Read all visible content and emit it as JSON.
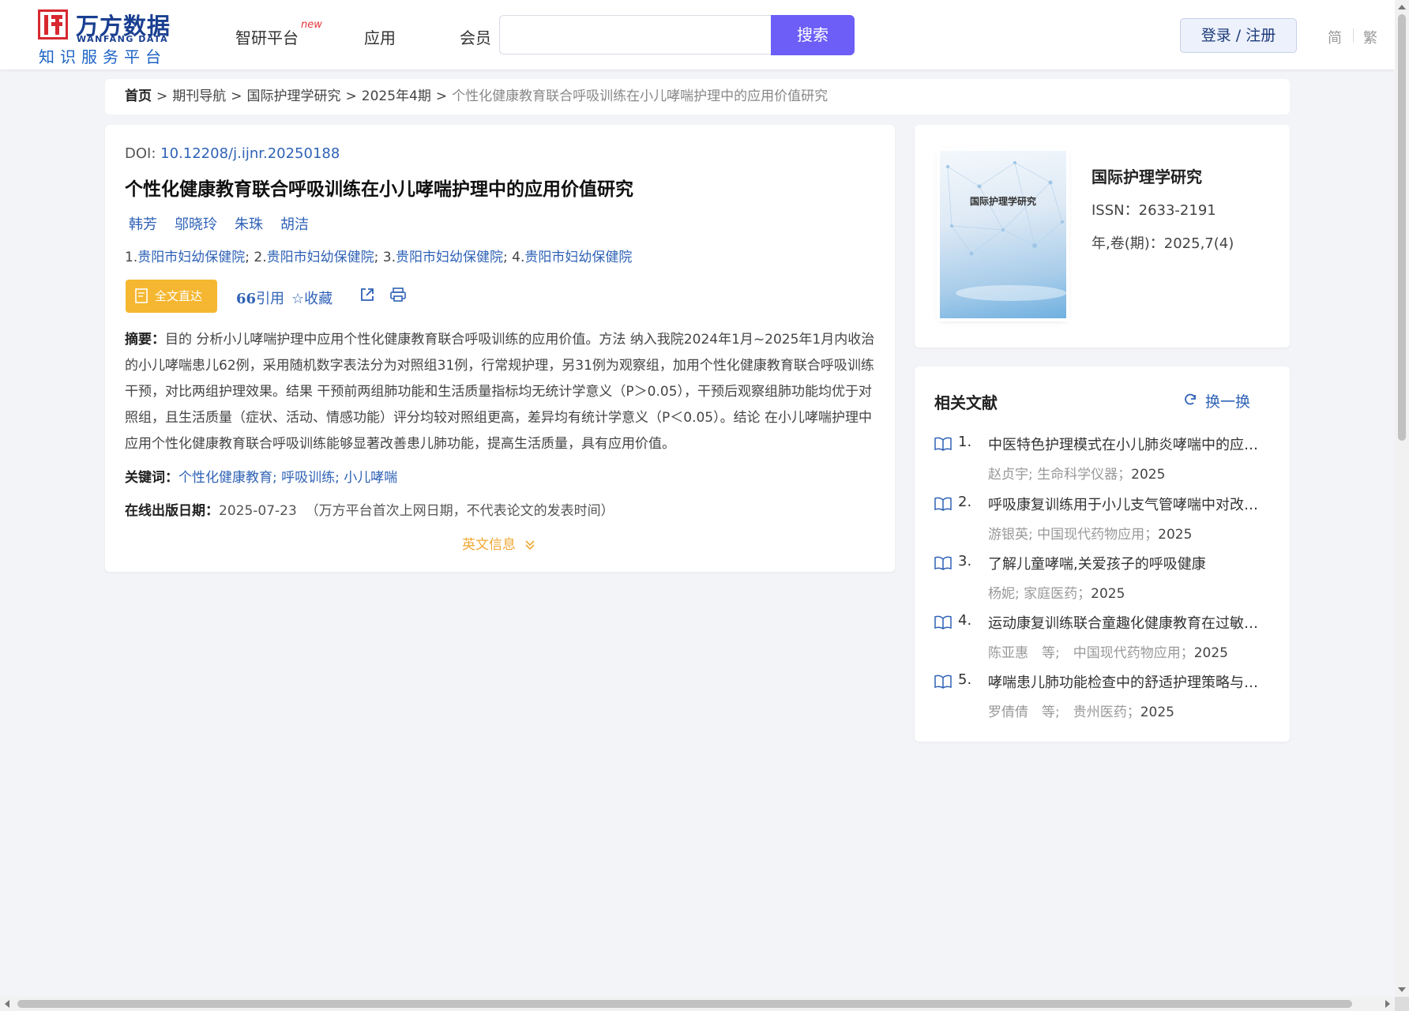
{
  "header": {
    "logo_cn": "万方数据",
    "logo_en": "WANFANG DATA",
    "logo_sub": "知识服务平台",
    "nav": [
      {
        "label": "智研平台",
        "badge": "new"
      },
      {
        "label": "应用"
      },
      {
        "label": "会员"
      }
    ],
    "search": {
      "value": "",
      "button": "搜索"
    },
    "login": "登录 / 注册",
    "lang_simplified": "简",
    "lang_traditional": "繁"
  },
  "breadcrumb": {
    "home": "首页",
    "items": [
      "期刊导航",
      "国际护理学研究",
      "2025年4期"
    ],
    "sep": ">",
    "current": "个性化健康教育联合呼吸训练在小儿哮喘护理中的应用价值研究"
  },
  "article": {
    "doi_label": "DOI:",
    "doi": "10.12208/j.ijnr.20250188",
    "title": "个性化健康教育联合呼吸训练在小儿哮喘护理中的应用价值研究",
    "authors": [
      "韩芳",
      "邬晓玲",
      "朱珠",
      "胡洁"
    ],
    "affiliations": [
      {
        "num": "1.",
        "org": "贵阳市妇幼保健院",
        "sep": ";"
      },
      {
        "num": "2.",
        "org": "贵阳市妇幼保健院",
        "sep": ";"
      },
      {
        "num": "3.",
        "org": "贵阳市妇幼保健院",
        "sep": ";"
      },
      {
        "num": "4.",
        "org": "贵阳市妇幼保健院",
        "sep": ""
      }
    ],
    "fulltext_button": "全文直达",
    "tools": {
      "cite": "引用",
      "favorite": "收藏"
    },
    "abstract_label": "摘要：",
    "abstract": "目的 分析小儿哮喘护理中应用个性化健康教育联合呼吸训练的应用价值。方法 纳入我院2024年1月~2025年1月内收治的小儿哮喘患儿62例，采用随机数字表法分为对照组31例，行常规护理，另31例为观察组，加用个性化健康教育联合呼吸训练干预，对比两组护理效果。结果 干预前两组肺功能和生活质量指标均无统计学意义（P＞0.05），干预后观察组肺功能均优于对照组，且生活质量（症状、活动、情感功能）评分均较对照组更高，差异均有统计学意义（P＜0.05）。结论 在小儿哮喘护理中应用个性化健康教育联合呼吸训练能够显著改善患儿肺功能，提高生活质量，具有应用价值。",
    "keywords_label": "关键词：",
    "keywords": [
      "个性化健康教育",
      "呼吸训练",
      "小儿哮喘"
    ],
    "pubdate_label": "在线出版日期：",
    "pubdate": "2025-07-23",
    "pubdate_note": "（万方平台首次上网日期，不代表论文的发表时间）",
    "english_info": "英文信息"
  },
  "journal": {
    "cover_title": "国际护理学研究",
    "name": "国际护理学研究",
    "issn": "ISSN：2633-2191",
    "volume": "年,卷(期)：2025,7(4)"
  },
  "related": {
    "heading": "相关文献",
    "refresh": "换一换",
    "items": [
      {
        "num": "1.",
        "title": "中医特色护理模式在小儿肺炎哮喘中的应用效果",
        "meta": "赵贞宇; 生命科学仪器；",
        "year": "2025"
      },
      {
        "num": "2.",
        "title": "呼吸康复训练用于小儿支气管哮喘中对改善肺功能的效果",
        "meta": "游银英; 中国现代药物应用；",
        "year": "2025"
      },
      {
        "num": "3.",
        "title": "了解儿童哮喘,关爱孩子的呼吸健康",
        "meta": "杨妮; 家庭医药；",
        "year": "2025"
      },
      {
        "num": "4.",
        "title": "运动康复训练联合童趣化健康教育在过敏性哮喘患儿中的应用",
        "meta": "陈亚惠　等;　中国现代药物应用；",
        "year": "2025"
      },
      {
        "num": "5.",
        "title": "哮喘患儿肺功能检查中的舒适护理策略与实践探讨",
        "meta": "罗倩倩　等;　贵州医药；",
        "year": "2025"
      }
    ]
  },
  "colors": {
    "brand_blue": "#1a3f91",
    "link_blue": "#2f62b6",
    "search_purple": "#6c5ef7",
    "fulltext_orange": "#f5b731",
    "english_info_orange": "#f0a733",
    "new_badge_red": "#e8353b"
  }
}
